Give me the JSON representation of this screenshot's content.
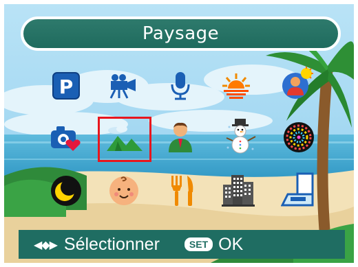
{
  "header": {
    "title": "Paysage"
  },
  "modes": [
    {
      "name": "program-mode",
      "icon": "p-icon"
    },
    {
      "name": "video-mode",
      "icon": "video-camera-icon"
    },
    {
      "name": "voice-record-mode",
      "icon": "microphone-icon"
    },
    {
      "name": "sunset-mode",
      "icon": "sunset-icon"
    },
    {
      "name": "backlight-portrait-mode",
      "icon": "backlight-portrait-icon"
    },
    {
      "name": "favorite-mode",
      "icon": "camera-heart-icon"
    },
    {
      "name": "landscape-mode",
      "icon": "landscape-icon",
      "selected": true
    },
    {
      "name": "portrait-mode",
      "icon": "person-icon"
    },
    {
      "name": "snow-mode",
      "icon": "snowman-icon"
    },
    {
      "name": "fireworks-mode",
      "icon": "fireworks-icon"
    },
    {
      "name": "night-mode",
      "icon": "moon-icon"
    },
    {
      "name": "kids-mode",
      "icon": "baby-face-icon"
    },
    {
      "name": "food-mode",
      "icon": "fork-knife-icon"
    },
    {
      "name": "building-mode",
      "icon": "building-icon"
    },
    {
      "name": "text-mode",
      "icon": "document-icon"
    }
  ],
  "footer": {
    "navigate_label": "Sélectionner",
    "set_badge": "SET",
    "ok_label": "OK"
  },
  "colors": {
    "bar": "#1f6d62",
    "selection": "#e8161d",
    "sky": "#a9d8f2",
    "sea": "#3aa6cf"
  }
}
